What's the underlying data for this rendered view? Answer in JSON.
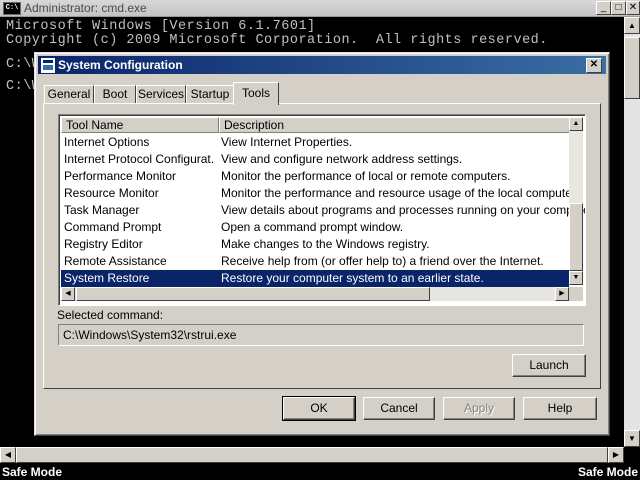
{
  "cmd": {
    "title": "Administrator: cmd.exe",
    "icon_label": "C:\\",
    "buttons": {
      "minimize": "_",
      "maximize": "□",
      "close": "✕"
    },
    "lines": [
      "Microsoft Windows [Version 6.1.7601]",
      "Copyright (c) 2009 Microsoft Corporation.  All rights reserved.",
      "",
      "C:\\W",
      "",
      "C:\\W"
    ]
  },
  "safe_mode": {
    "left": "Safe Mode",
    "right": "Safe Mode"
  },
  "dialog": {
    "title": "System Configuration",
    "close_glyph": "✕",
    "tabs": [
      {
        "label": "General",
        "active": false
      },
      {
        "label": "Boot",
        "active": false
      },
      {
        "label": "Services",
        "active": false
      },
      {
        "label": "Startup",
        "active": false
      },
      {
        "label": "Tools",
        "active": true
      }
    ],
    "list": {
      "columns": [
        "Tool Name",
        "Description"
      ],
      "rows": [
        {
          "name": "Internet Options",
          "description": "View Internet Properties.",
          "selected": false
        },
        {
          "name": "Internet Protocol Configurat...",
          "description": "View and configure network address settings.",
          "selected": false
        },
        {
          "name": "Performance Monitor",
          "description": "Monitor the performance of local or remote computers.",
          "selected": false
        },
        {
          "name": "Resource Monitor",
          "description": "Monitor the performance and resource usage of the local computer.",
          "selected": false
        },
        {
          "name": "Task Manager",
          "description": "View details about programs and processes running on your computer.",
          "selected": false
        },
        {
          "name": "Command Prompt",
          "description": "Open a command prompt window.",
          "selected": false
        },
        {
          "name": "Registry Editor",
          "description": "Make changes to the Windows registry.",
          "selected": false
        },
        {
          "name": "Remote Assistance",
          "description": "Receive help from (or offer help to) a friend over the Internet.",
          "selected": false
        },
        {
          "name": "System Restore",
          "description": "Restore your computer system to an earlier state.",
          "selected": true
        }
      ]
    },
    "selected_command_label": "Selected command:",
    "selected_command_value": "C:\\Windows\\System32\\rstrui.exe",
    "launch_label": "Launch",
    "buttons": {
      "ok": "OK",
      "cancel": "Cancel",
      "apply": "Apply",
      "help": "Help"
    }
  }
}
